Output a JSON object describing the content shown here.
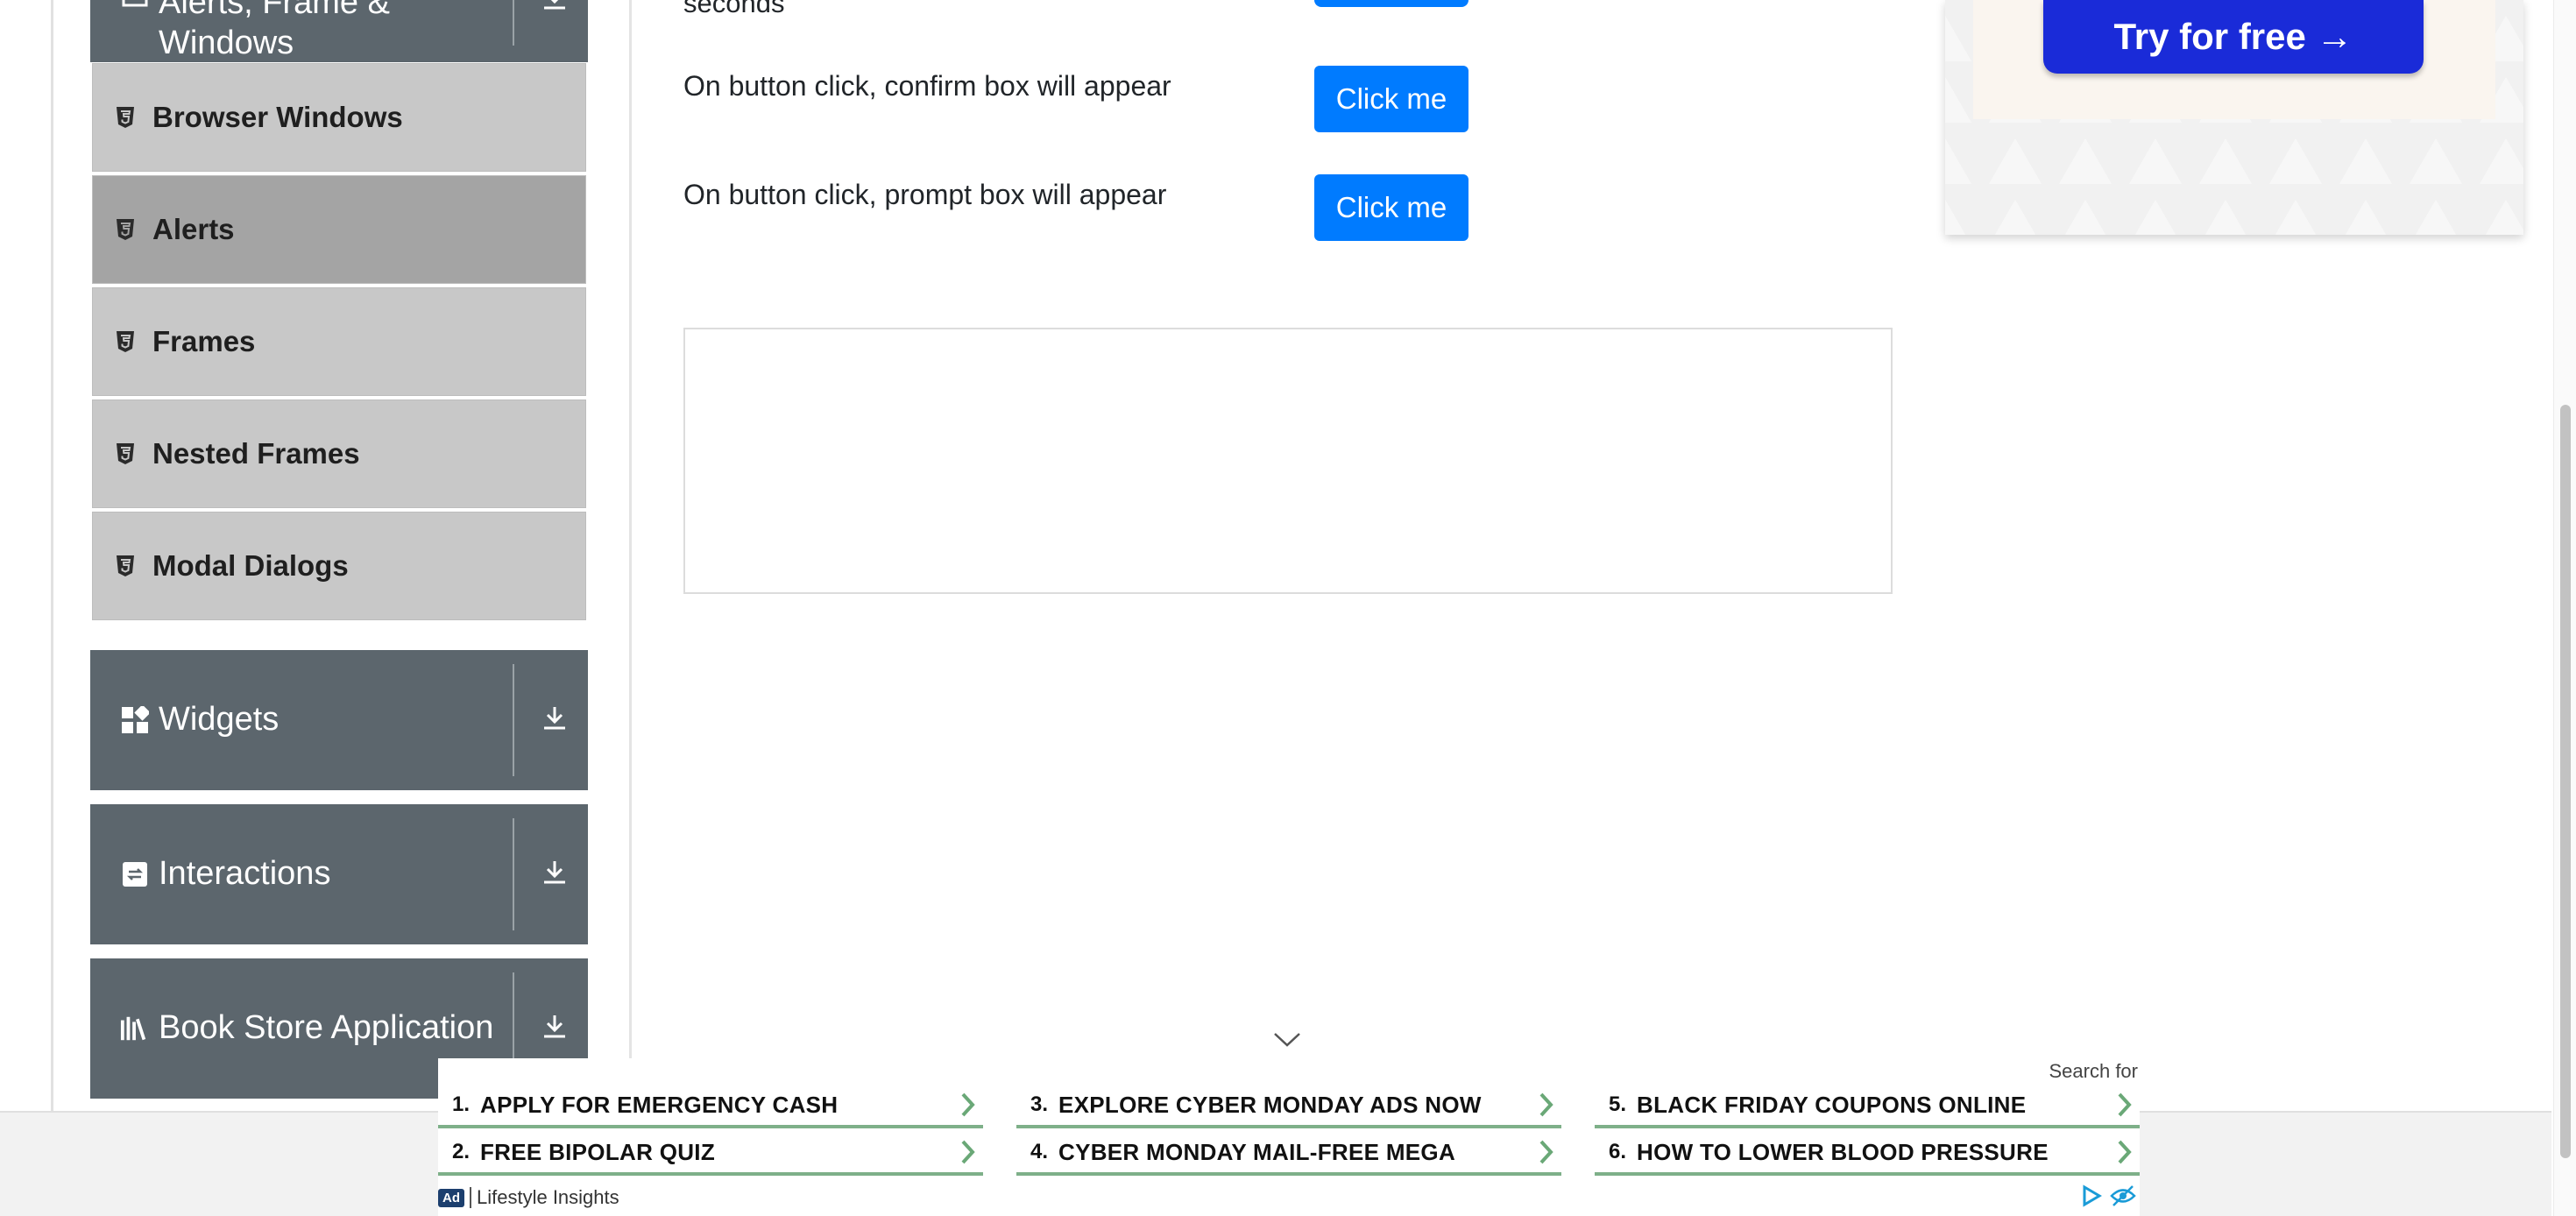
{
  "sidebar": {
    "top_group": {
      "label_line1": "Alerts, Frame &",
      "label_line2": "Windows",
      "icon": "list-icon"
    },
    "items": [
      {
        "label": "Browser Windows",
        "icon": "html5-icon",
        "active": false
      },
      {
        "label": "Alerts",
        "icon": "html5-icon",
        "active": true
      },
      {
        "label": "Frames",
        "icon": "html5-icon",
        "active": false
      },
      {
        "label": "Nested Frames",
        "icon": "html5-icon",
        "active": false
      },
      {
        "label": "Modal Dialogs",
        "icon": "html5-icon",
        "active": false
      }
    ],
    "groups": [
      {
        "label": "Widgets",
        "icon": "widgets-icon"
      },
      {
        "label": "Interactions",
        "icon": "interactions-icon"
      },
      {
        "label": "Book Store Application",
        "icon": "bookstore-icon"
      }
    ]
  },
  "main": {
    "text_fragment": "seconds",
    "rows": [
      {
        "label": "On button click, confirm box will appear",
        "button": "Click me"
      },
      {
        "label": "On button click, prompt box will appear",
        "button": "Click me"
      }
    ]
  },
  "ad_top": {
    "button_label": "Try for free →"
  },
  "search_ad": {
    "header": "Search for",
    "links": [
      {
        "num": "1.",
        "text": "APPLY FOR EMERGENCY CASH"
      },
      {
        "num": "2.",
        "text": "FREE BIPOLAR QUIZ"
      },
      {
        "num": "3.",
        "text": "EXPLORE CYBER MONDAY ADS NOW"
      },
      {
        "num": "4.",
        "text": "CYBER MONDAY MAIL-FREE MEGA"
      },
      {
        "num": "5.",
        "text": "BLACK FRIDAY COUPONS ONLINE"
      },
      {
        "num": "6.",
        "text": "HOW TO LOWER BLOOD PRESSURE"
      }
    ],
    "badge": "Ad",
    "sponsor": "Lifestyle Insights"
  },
  "colors": {
    "sidebar_header": "#5c666d",
    "menu_item": "#c8c8c8",
    "menu_item_active": "#a4a4a4",
    "button_primary": "#007bff",
    "ad_cta": "#1a2bd8",
    "ad_link_underline": "#7eb089"
  }
}
